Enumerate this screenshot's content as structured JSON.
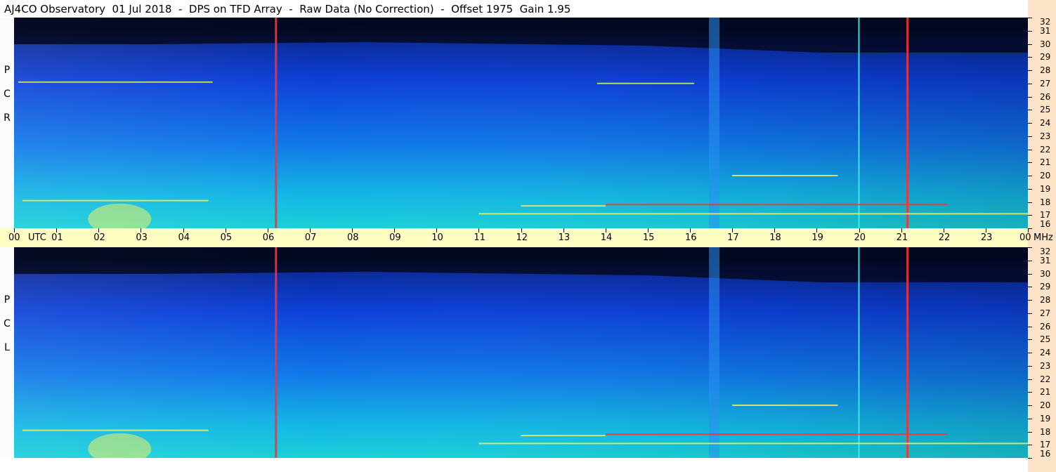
{
  "header": {
    "title": "AJ4CO Observatory  01 Jul 2018  -  DPS on TFD Array  -  Raw Data (No Correction)  -  Offset 1975  Gain 1.95"
  },
  "panels": {
    "top": {
      "polarization_letters": [
        "R",
        "C",
        "P"
      ]
    },
    "bottom": {
      "polarization_letters": [
        "L",
        "C",
        "P"
      ]
    }
  },
  "time_axis": {
    "labels": [
      "00",
      "01",
      "02",
      "03",
      "04",
      "05",
      "06",
      "07",
      "08",
      "09",
      "10",
      "11",
      "12",
      "13",
      "14",
      "15",
      "16",
      "17",
      "18",
      "19",
      "20",
      "21",
      "22",
      "23",
      "00"
    ],
    "utc_label": "UTC",
    "unit_label": "MHz"
  },
  "colors": {
    "background_dark": "#050b2a",
    "background_blue": "#1040e0",
    "low_freq_cyan": "#18d8d0",
    "rfi_yellow": "#f0f060",
    "rfi_red": "#ff3030",
    "time_bar": "#ffffc4",
    "freq_strip": "#fde3c7"
  },
  "chart_data": {
    "type": "heatmap",
    "title": "AJ4CO Observatory  01 Jul 2018  -  DPS on TFD Array  -  Raw Data (No Correction)  -  Offset 1975  Gain 1.95",
    "x": {
      "label": "UTC",
      "range": [
        0,
        24
      ],
      "ticks": [
        "00",
        "01",
        "02",
        "03",
        "04",
        "05",
        "06",
        "07",
        "08",
        "09",
        "10",
        "11",
        "12",
        "13",
        "14",
        "15",
        "16",
        "17",
        "18",
        "19",
        "20",
        "21",
        "22",
        "23",
        "00"
      ]
    },
    "y": {
      "label": "MHz",
      "range": [
        16,
        32
      ],
      "ticks": [
        16,
        17,
        18,
        19,
        20,
        21,
        22,
        23,
        24,
        25,
        26,
        27,
        28,
        29,
        30,
        31,
        32
      ]
    },
    "panels": [
      "RCP",
      "LCP"
    ],
    "features": [
      {
        "kind": "vertical_line",
        "color": "red",
        "utc": 6.2
      },
      {
        "kind": "vertical_line",
        "color": "red",
        "utc": 21.15
      },
      {
        "kind": "vertical_band",
        "color": "blue-cyan",
        "utc_start": 16.45,
        "utc_end": 16.7
      },
      {
        "kind": "vertical_line",
        "color": "cyan",
        "utc": 20.0
      },
      {
        "kind": "horizontal_line",
        "color": "yellow-green",
        "mhz": 27.1,
        "utc_start": 0.1,
        "utc_end": 4.7
      },
      {
        "kind": "horizontal_line",
        "color": "yellow-green",
        "mhz": 27.0,
        "utc_start": 13.8,
        "utc_end": 16.1
      },
      {
        "kind": "horizontal_line",
        "color": "yellow",
        "mhz": 18.1,
        "utc_start": 0.2,
        "utc_end": 4.6
      },
      {
        "kind": "horizontal_line",
        "color": "yellow",
        "mhz": 17.7,
        "utc_start": 12.0,
        "utc_end": 14.0
      },
      {
        "kind": "horizontal_line",
        "color": "red",
        "mhz": 17.8,
        "utc_start": 14.0,
        "utc_end": 22.1
      },
      {
        "kind": "horizontal_line",
        "color": "yellow",
        "mhz": 17.1,
        "utc_start": 11.0,
        "utc_end": 24.0
      },
      {
        "kind": "horizontal_line",
        "color": "yellow",
        "mhz": 20.0,
        "utc_start": 17.0,
        "utc_end": 19.5
      },
      {
        "kind": "blob",
        "color": "yellow",
        "utc": 2.5,
        "mhz": 16.7
      }
    ]
  }
}
